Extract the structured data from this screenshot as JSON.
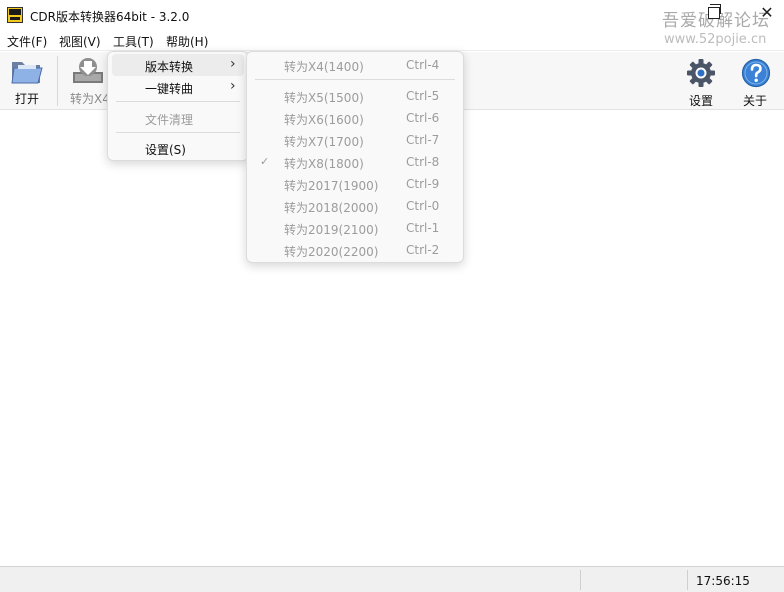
{
  "window": {
    "title": "CDR版本转换器64bit - 3.2.0",
    "close_glyph": "✕",
    "watermark_line1": "吾爱破解论坛",
    "watermark_line2": "www.52pojie.cn"
  },
  "menubar": [
    {
      "label": "文件(F)"
    },
    {
      "label": "视图(V)"
    },
    {
      "label": "工具(T)"
    },
    {
      "label": "帮助(H)"
    }
  ],
  "toolbar": {
    "open_label": "打开",
    "convert_label": "转为X4",
    "settings_label": "设置",
    "about_label": "关于"
  },
  "tools_menu": {
    "items": [
      {
        "label": "版本转换",
        "has_submenu": true,
        "highlighted": true,
        "disabled": false
      },
      {
        "label": "一键转曲",
        "has_submenu": true,
        "highlighted": false,
        "disabled": false
      },
      {
        "label": "文件清理",
        "has_submenu": false,
        "highlighted": false,
        "disabled": true
      },
      {
        "label": "设置(S)",
        "has_submenu": false,
        "highlighted": false,
        "disabled": false
      }
    ]
  },
  "version_submenu": {
    "items": [
      {
        "label": "转为X4(1400)",
        "shortcut": "Ctrl-4",
        "checked": false
      },
      {
        "label": "转为X5(1500)",
        "shortcut": "Ctrl-5",
        "checked": false
      },
      {
        "label": "转为X6(1600)",
        "shortcut": "Ctrl-6",
        "checked": false
      },
      {
        "label": "转为X7(1700)",
        "shortcut": "Ctrl-7",
        "checked": false
      },
      {
        "label": "转为X8(1800)",
        "shortcut": "Ctrl-8",
        "checked": true
      },
      {
        "label": "转为2017(1900)",
        "shortcut": "Ctrl-9",
        "checked": false
      },
      {
        "label": "转为2018(2000)",
        "shortcut": "Ctrl-0",
        "checked": false
      },
      {
        "label": "转为2019(2100)",
        "shortcut": "Ctrl-1",
        "checked": false
      },
      {
        "label": "转为2020(2200)",
        "shortcut": "Ctrl-2",
        "checked": false
      }
    ],
    "check_glyph": "✓"
  },
  "status": {
    "time": "17:56:15"
  },
  "colors": {
    "settings_icon": "#4a5568",
    "about_icon": "#2f78c4",
    "open_icon": "#5d86c9",
    "app_icon": "#f2c91c"
  },
  "icons": {
    "open": "folder-open-icon",
    "convert": "download-tray-icon",
    "settings": "gear-icon",
    "about": "help-circle-icon"
  }
}
